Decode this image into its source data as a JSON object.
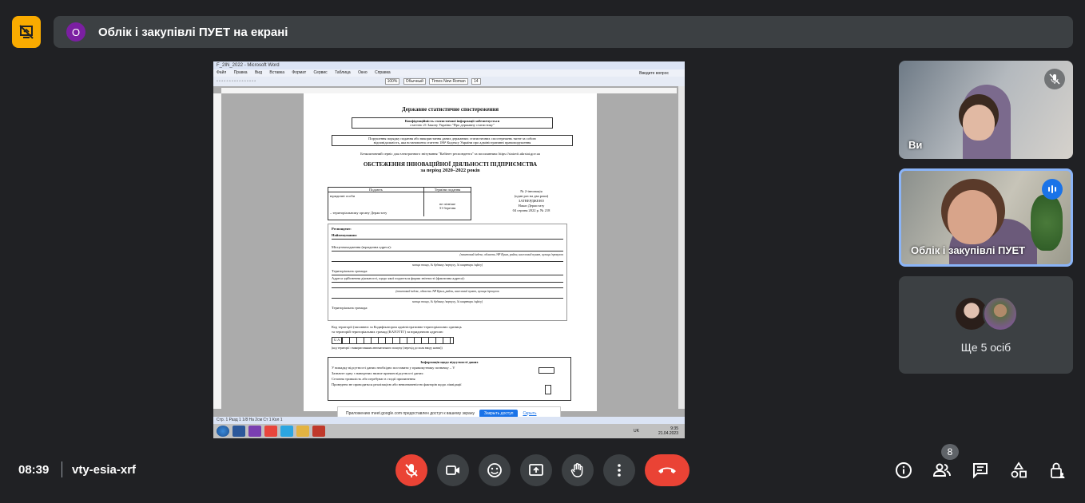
{
  "banner": {
    "avatar_letter": "О",
    "title": "Облік і закупівлі ПУЕТ на екрані"
  },
  "screen": {
    "window_title": "F_2IN_2022 - Microsoft Word",
    "menu": [
      "Файл",
      "Правка",
      "Вид",
      "Вставка",
      "Формат",
      "Сервис",
      "Таблица",
      "Окно",
      "Справка"
    ],
    "zoom": "100%",
    "style": "Обычный",
    "font": "Times New Roman",
    "font_size": "14",
    "search_placeholder": "Введите вопрос",
    "doc": {
      "h1": "Державне статистичне спостереження",
      "conf1": "Конфіденційність статистичної інформації забезпечується",
      "conf2": "статтею 21 Закону України \"Про державну статистику\"",
      "warn1": "Порушення порядку подання або використання даних державних статистичних спостережень тягне за собою",
      "warn2": "відповідальність, яка встановлена статтею 186³ Кодексу України про адміністративні правопорушення",
      "online": "Безкоштовний сервіс для електронного звітування \"Кабінет респондента\" за посиланням: https://statzvit.ukrstat.gov.ua",
      "title1": "ОБСТЕЖЕННЯ ІННОВАЦІЙНОЇ ДІЯЛЬНОСТІ ПІДПРИЄМСТВА",
      "title2": "за період 2020–2022 років",
      "col1": "Подають",
      "col2": "Терміни подання",
      "cell1": "юридичні особи",
      "cell2": "– територіальному органу Держстату",
      "cell3": "не пізніше",
      "cell4": "31 березня",
      "form1": "№ 2-інновація",
      "form2": "(один раз на два роки)",
      "form3": "ЗАТВЕРДЖЕНО",
      "form4": "Наказ Держстату",
      "form5": "04 серпня 2022 р. № 218",
      "resp": "Респондент:",
      "name": "Найменування:",
      "loc": "Місцезнаходження (юридична адреса):",
      "loc_hint": "(поштовий індекс, область /АР Крим, район, населений пункт, вулиця /провулок",
      "loc_hint2": "площа тощо, № будинку /корпусу, № квартири /офісу)",
      "terr": "Територіальна громада:",
      "addr": "Адреса здійснення діяльності, щодо якої подається форма звітності (фактична адреса):",
      "terr2": "Територіальна громада:",
      "katottg1": "Код території (заповнює за Кодифікатором адміністративно-територіальних одиниць",
      "katottg2": "та територій територіальних громад (КАТОТТГ) за юридичною адресою",
      "code_prefix": "U A",
      "katottg3": "(код території з використанням автоматичного пошуку (перехід до поля вводу назви))",
      "absent_title": "Інформація щодо відсутності даних",
      "absent1": "У випадку відсутності даних необхідно поставити у прямокутнику позначку – V",
      "absent2": "Зазначте одну з наведених нижче причин відсутності даних:",
      "absent3": "Сезонна тривалість або перебуває в стадії припинення",
      "absent4": "Проведено не проводиться реалізацією або невизначеністю факторів щодо ліквідації"
    },
    "status": "Стр. 1   Разд 1   1/8   На 2см   Ст 1   Кол 1",
    "share_note": "Приложению meet.google.com предоставлен доступ к вашему экрану",
    "share_stop": "Закрыть доступ",
    "share_hide": "Скрыть",
    "lang": "UK",
    "time": "9:35",
    "date": "21.04.2023"
  },
  "tiles": {
    "tile1_label": "Ви",
    "tile2_label": "Облік і закупівлі ПУЕТ",
    "more_label": "Ще 5 осіб"
  },
  "bottom": {
    "clock": "08:39",
    "meet_code": "vty-esia-xrf",
    "participant_count": "8"
  },
  "colors": {
    "accent": "#8ab4f8",
    "danger": "#ea4335",
    "present": "#f9ab00",
    "avatar": "#7b1fa2"
  }
}
